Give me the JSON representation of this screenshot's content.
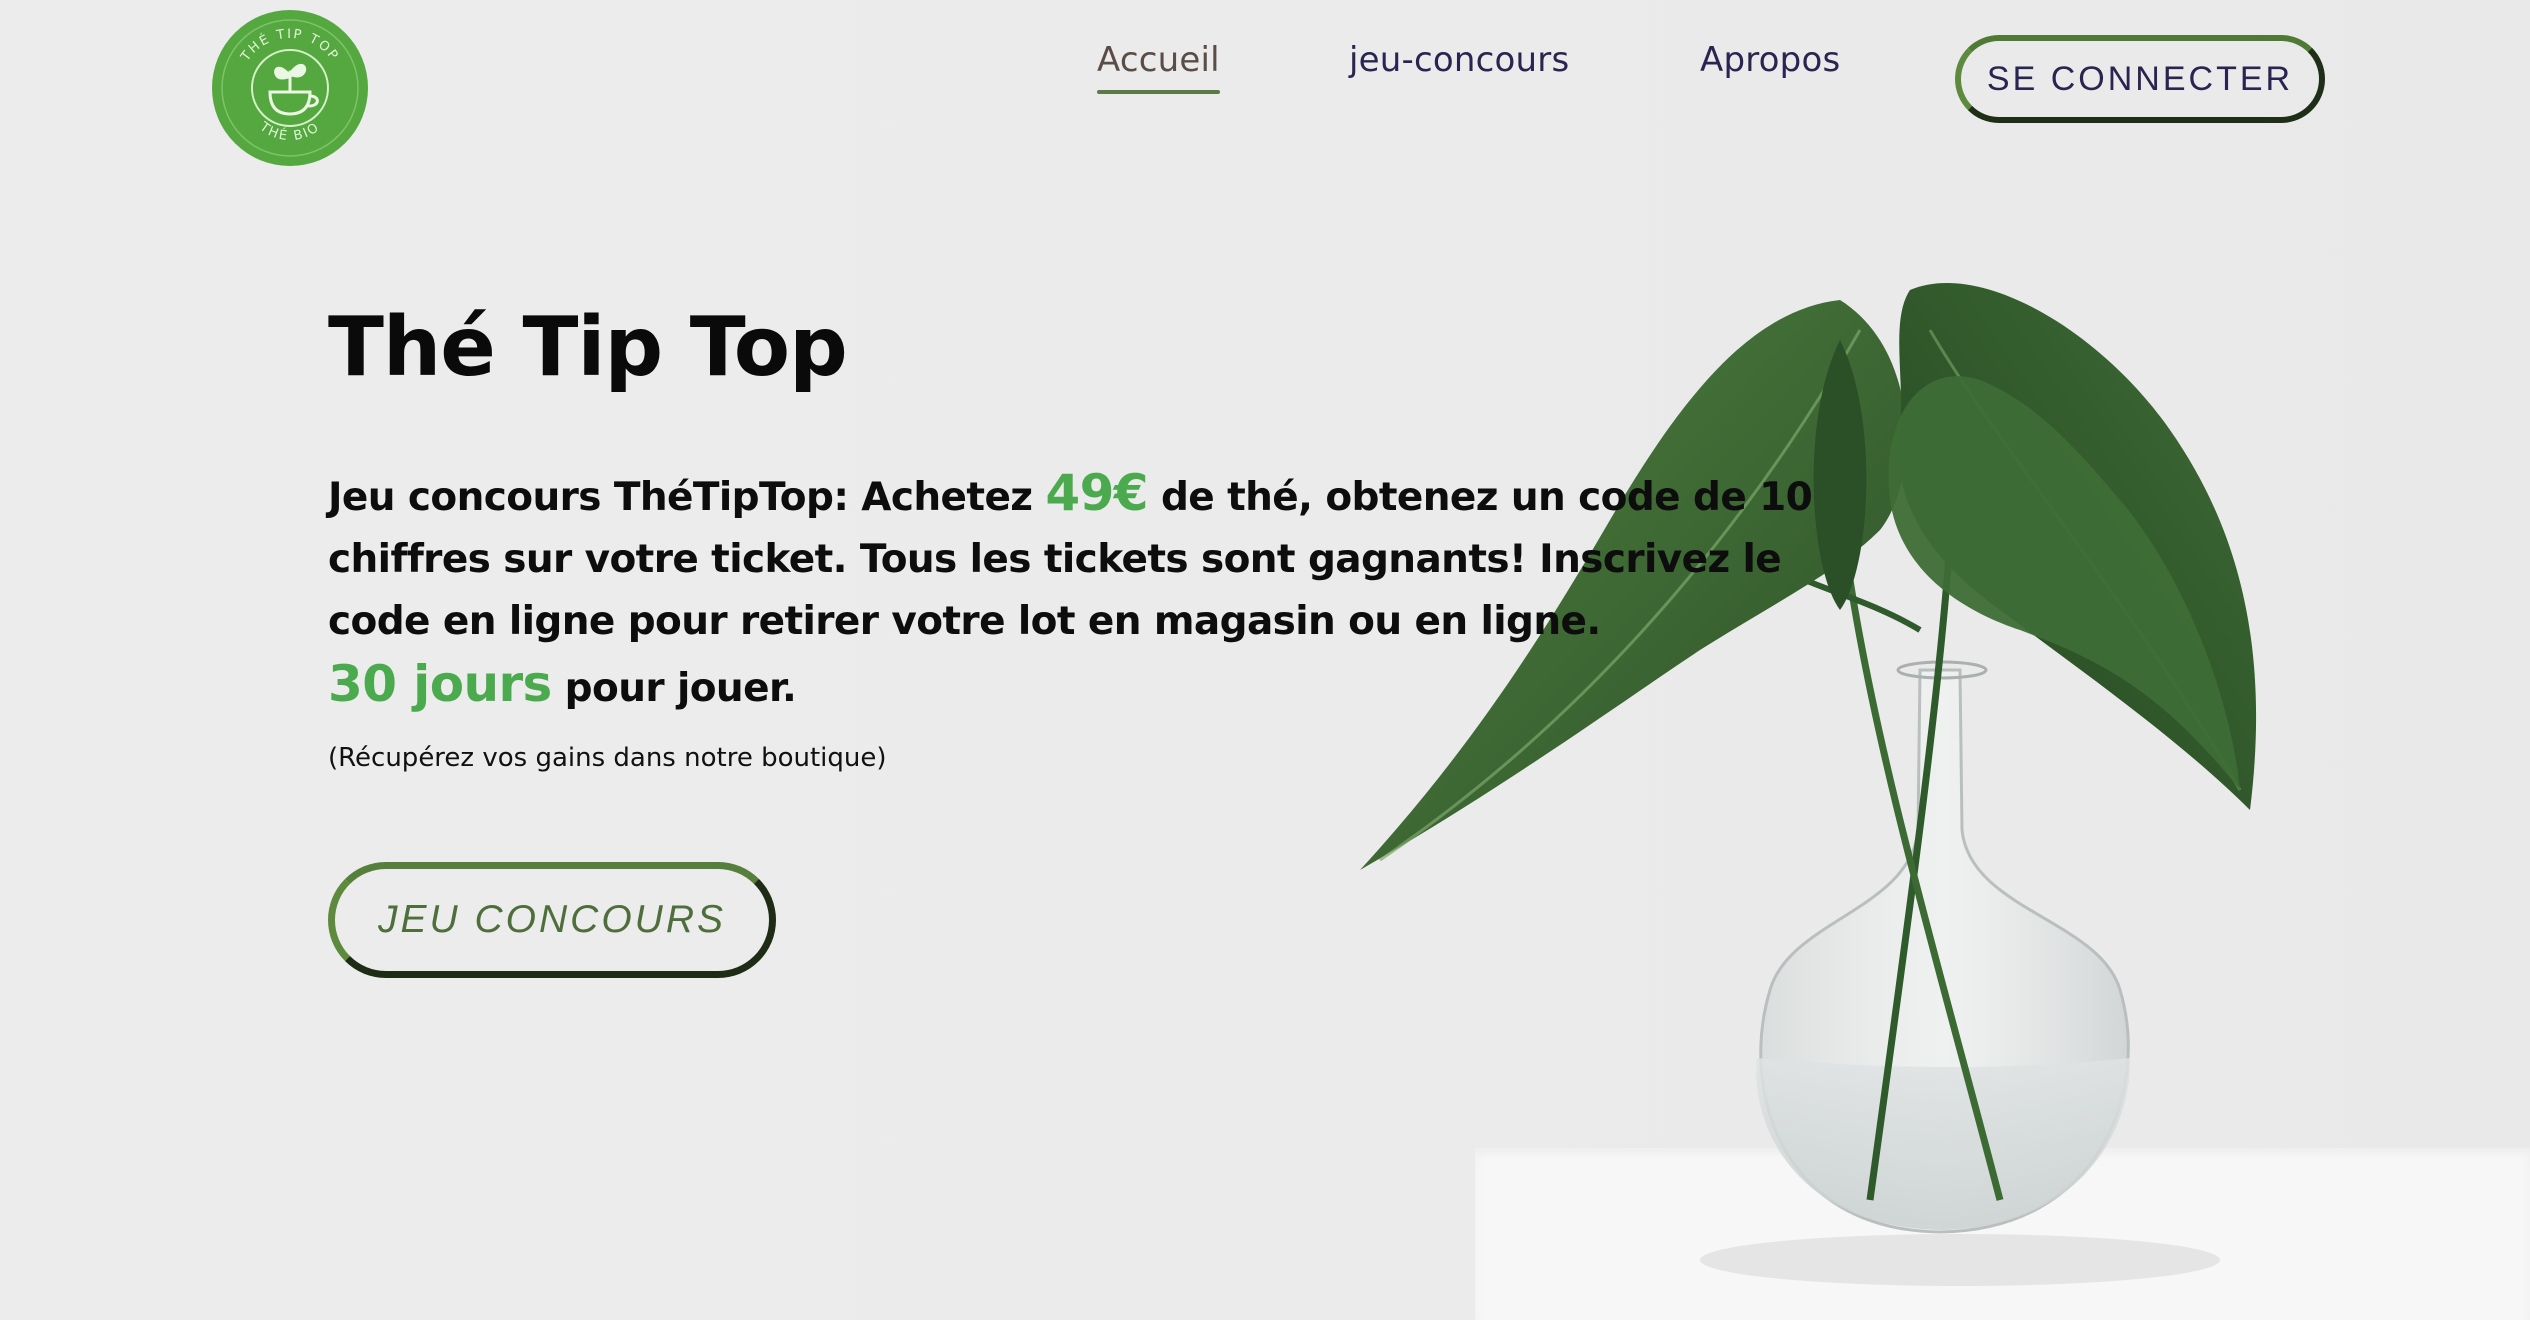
{
  "brand": {
    "logo_top_text": "THÉ TIP TOP",
    "logo_bottom_text": "THÉ BIO",
    "logo_icon": "teacup-sprout-icon",
    "logo_color": "#54a83f"
  },
  "nav": {
    "items": [
      {
        "label": "Accueil",
        "active": true
      },
      {
        "label": "jeu-concours",
        "active": false
      },
      {
        "label": "Apropos",
        "active": false
      }
    ],
    "login_button": "SE CONNECTER"
  },
  "hero": {
    "title": "Thé Tip Top",
    "line1_start": "Jeu concours ThéTipTop: Achetez ",
    "line1_amount": "49€",
    "line1_end": " de thé, obtenez un code de 10",
    "line2": "chiffres sur votre ticket. Tous les tickets sont gagnants! Inscrivez le",
    "line3": "code en ligne pour retirer votre lot en magasin ou en ligne.",
    "line4_duration": "30 jours",
    "line4_end": " pour jouer.",
    "note": "(Récupérez vos gains dans notre boutique)",
    "cta_button": "JEU CONCOURS"
  },
  "colors": {
    "accent_green": "#4caa4e",
    "button_border_dark": "#1f2e16",
    "button_border_light": "#5e8a3e",
    "nav_text": "#2a2550",
    "background": "#ebebeb"
  }
}
